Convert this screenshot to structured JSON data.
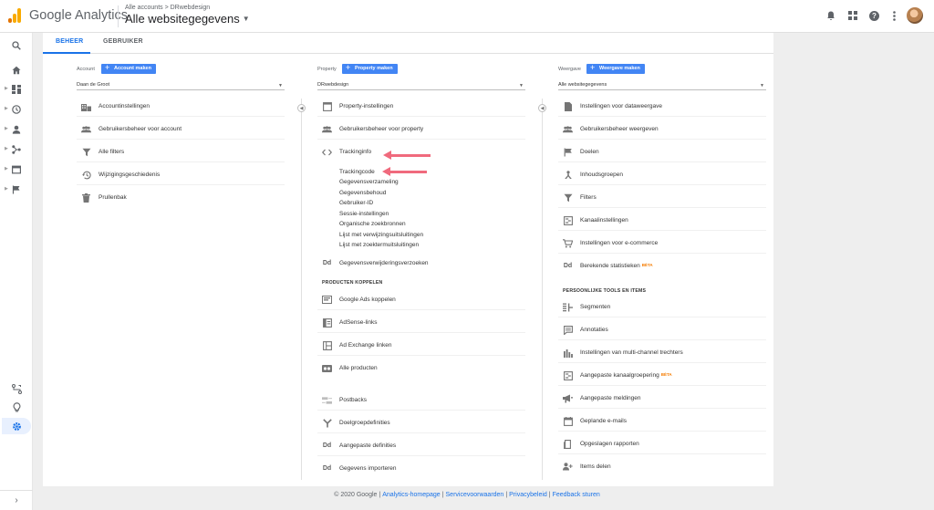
{
  "header": {
    "product_name": "Google Analytics",
    "breadcrumb": "Alle accounts > DRwebdesign",
    "view_selector": "Alle websitegegevens"
  },
  "tabs": [
    {
      "label": "BEHEER",
      "active": true
    },
    {
      "label": "GEBRUIKER",
      "active": false
    }
  ],
  "account_column": {
    "label": "Account",
    "create_button": "Account maken",
    "selected": "Daan de Groot",
    "items": [
      {
        "label": "Accountinstellingen",
        "icon": "building-icon"
      },
      {
        "label": "Gebruikersbeheer voor account",
        "icon": "users-icon"
      },
      {
        "label": "Alle filters",
        "icon": "filter-icon"
      },
      {
        "label": "Wijzigingsgeschiedenis",
        "icon": "history-icon"
      },
      {
        "label": "Prullenbak",
        "icon": "trash-icon"
      }
    ]
  },
  "property_column": {
    "label": "Property",
    "create_button": "Property maken",
    "selected": "DRwebdesign",
    "items": [
      {
        "label": "Property-instellingen",
        "icon": "window-icon"
      },
      {
        "label": "Gebruikersbeheer voor property",
        "icon": "users-icon"
      },
      {
        "label": "Trackinginfo",
        "icon": "code-icon"
      }
    ],
    "tracking_sub": [
      "Trackingcode",
      "Gegevensverzameling",
      "Gegevensbehoud",
      "Gebruiker-ID",
      "Sessie-instellingen",
      "Organische zoekbronnen",
      "Lijst met verwijzingsuitsluitingen",
      "Lijst met zoektermuitsluitingen"
    ],
    "deletion_item": {
      "label": "Gegevensverwijderingsverzoeken",
      "icon_text": "Dd"
    },
    "section_title": "PRODUCTEN KOPPELEN",
    "linking_items": [
      {
        "label": "Google Ads koppelen",
        "icon": "ads-icon"
      },
      {
        "label": "AdSense-links",
        "icon": "adsense-icon"
      },
      {
        "label": "Ad Exchange linken",
        "icon": "adexchange-icon"
      },
      {
        "label": "Alle producten",
        "icon": "products-icon"
      }
    ],
    "bottom_items": [
      {
        "label": "Postbacks",
        "icon": "postbacks-icon"
      },
      {
        "label": "Doelgroepdefinities",
        "icon": "audience-icon"
      },
      {
        "label": "Aangepaste definities",
        "icon_text": "Dd"
      },
      {
        "label": "Gegevens importeren",
        "icon_text": "Dd"
      }
    ]
  },
  "view_column": {
    "label": "Weergave",
    "create_button": "Weergave maken",
    "selected": "Alle websitegegevens",
    "items": [
      {
        "label": "Instellingen voor dataweergave",
        "icon": "document-icon"
      },
      {
        "label": "Gebruikersbeheer weergeven",
        "icon": "users-icon"
      },
      {
        "label": "Doelen",
        "icon": "flag-icon"
      },
      {
        "label": "Inhoudsgroepen",
        "icon": "content-groups-icon"
      },
      {
        "label": "Filters",
        "icon": "filter-icon"
      },
      {
        "label": "Kanaalinstellingen",
        "icon": "channel-icon"
      },
      {
        "label": "Instellingen voor e-commerce",
        "icon": "cart-icon"
      },
      {
        "label": "Berekende statistieken",
        "icon_text": "Dd",
        "beta": "BÈTA"
      }
    ],
    "section_title": "PERSOONLIJKE TOOLS EN ITEMS",
    "personal_items": [
      {
        "label": "Segmenten",
        "icon": "segments-icon"
      },
      {
        "label": "Annotaties",
        "icon": "annotation-icon"
      },
      {
        "label": "Instellingen van multi-channel trechters",
        "icon": "bar-chart-icon"
      },
      {
        "label": "Aangepaste kanaalgroepering",
        "icon": "channel-icon",
        "beta": "BÈTA"
      },
      {
        "label": "Aangepaste meldingen",
        "icon": "megaphone-icon"
      },
      {
        "label": "Geplande e-mails",
        "icon": "calendar-icon"
      },
      {
        "label": "Opgeslagen rapporten",
        "icon": "saved-icon"
      },
      {
        "label": "Items delen",
        "icon": "share-user-icon"
      }
    ]
  },
  "footer": {
    "copyright": "© 2020 Google",
    "links": [
      "Analytics-homepage",
      "Servicevoorwaarden",
      "Privacybeleid",
      "Feedback sturen"
    ]
  },
  "colors": {
    "accent": "#1a73e8",
    "button": "#4285f4",
    "arrow": "#f06a7d",
    "beta": "#f57c00"
  }
}
